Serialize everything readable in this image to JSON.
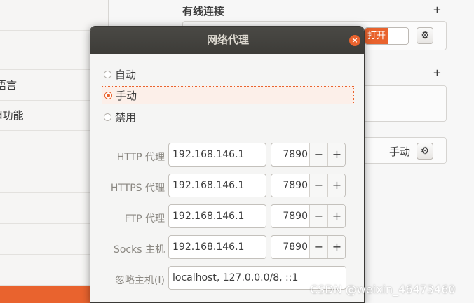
{
  "sidebar": {
    "items": [
      "",
      "",
      "语言",
      "d功能",
      "",
      "",
      "",
      "",
      "",
      ""
    ],
    "active_color": "#e9632e"
  },
  "main": {
    "wired_section_title": "有线连接",
    "wired_toggle_label": "打开",
    "vpn_plus": "+",
    "wired_plus": "+",
    "proxy_mode_value": "手动"
  },
  "dialog": {
    "title": "网络代理",
    "close_glyph": "×",
    "modes": [
      {
        "label": "自动",
        "checked": false
      },
      {
        "label": "手动",
        "checked": true
      },
      {
        "label": "禁用",
        "checked": false
      }
    ],
    "proxies": [
      {
        "label": "HTTP 代理",
        "host": "192.168.146.1",
        "port": "7890"
      },
      {
        "label": "HTTPS 代理",
        "host": "192.168.146.1",
        "port": "7890"
      },
      {
        "label": "FTP 代理",
        "host": "192.168.146.1",
        "port": "7890"
      },
      {
        "label": "Socks 主机",
        "host": "192.168.146.1",
        "port": "7890"
      }
    ],
    "ignore_label": "忽略主机(I)",
    "ignore_value": "localhost, 127.0.0.0/8, ::1",
    "minus_glyph": "−",
    "plus_glyph": "+"
  },
  "watermark": "CSDN @weixin_46473460",
  "colors": {
    "accent": "#e9632e",
    "titlebar": "#3d3c38"
  }
}
